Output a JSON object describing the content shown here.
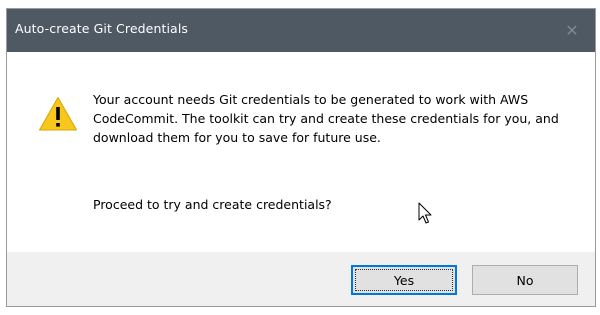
{
  "window": {
    "title": "Auto-create Git Credentials",
    "close_glyph": "✕"
  },
  "content": {
    "icon": "warning-icon",
    "message": "Your account needs Git credentials to be generated to work with AWS CodeCommit. The toolkit can try and create these credentials for you, and download them for you to save for future use.",
    "question": "Proceed to try and create credentials?"
  },
  "buttons": {
    "yes_label": "Yes",
    "no_label": "No"
  },
  "colors": {
    "titlebar": "#4e5964",
    "footer": "#f0f0f0",
    "warning": "#f7c71b",
    "accent": "#0078d7"
  }
}
